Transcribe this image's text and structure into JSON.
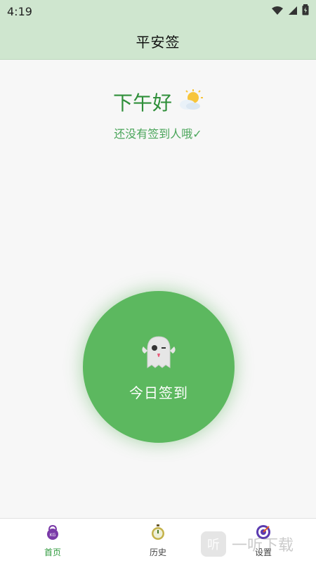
{
  "status_bar": {
    "time": "4:19",
    "icons": [
      "wifi-icon",
      "cell-signal-icon",
      "battery-icon"
    ]
  },
  "app_bar": {
    "title": "平安签"
  },
  "main": {
    "greeting": "下午好",
    "greeting_icon": "sun-behind-cloud-icon",
    "subtext": "还没有签到人哦✓",
    "checkin_button": {
      "label": "今日签到",
      "icon": "ghost-icon"
    }
  },
  "bottom_nav": {
    "items": [
      {
        "label": "首页",
        "icon": "kettlebell-icon",
        "active": true
      },
      {
        "label": "历史",
        "icon": "stopwatch-icon",
        "active": false
      },
      {
        "label": "设置",
        "icon": "target-icon",
        "active": false
      }
    ]
  },
  "watermark": {
    "logo_text": "听",
    "text": "一听下载"
  },
  "colors": {
    "header_bg": "#cfe6cf",
    "accent_green": "#5cb85f",
    "text_green": "#2f8f3a",
    "background": "#f7f7f7"
  }
}
